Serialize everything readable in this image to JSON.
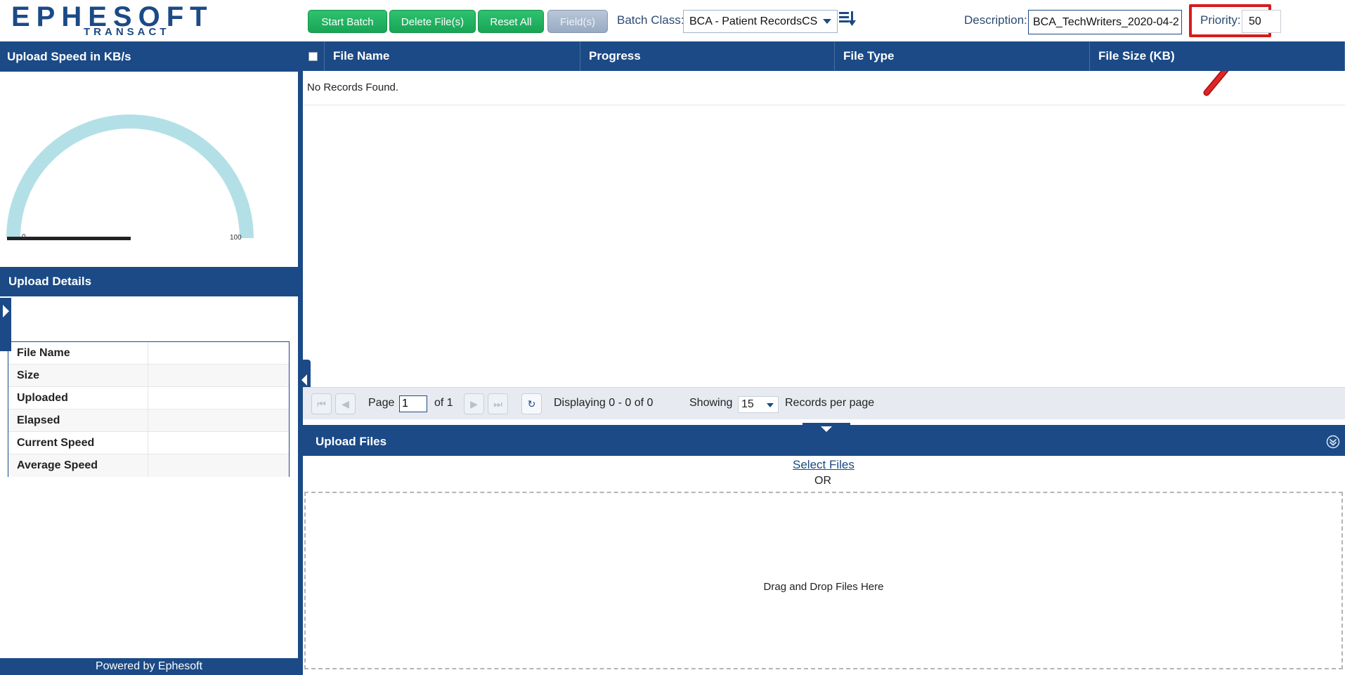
{
  "header": {
    "logo_text": "EPHESOFT",
    "logo_sub": "TRANSACT",
    "buttons": {
      "start_batch": "Start Batch",
      "delete_files": "Delete File(s)",
      "reset_all": "Reset All",
      "fields": "Field(s)"
    },
    "batch_class_label": "Batch Class:",
    "batch_class_value": "BCA - Patient RecordsCS",
    "description_label": "Description:",
    "description_value": "BCA_TechWriters_2020-04-2",
    "priority_label": "Priority:",
    "priority_value": "50"
  },
  "left": {
    "speed_title": "Upload Speed in KB/s",
    "gauge": {
      "min_label": "0",
      "max_label": "100",
      "value": 0
    },
    "details_title": "Upload Details",
    "details_rows": [
      {
        "label": "File Name",
        "value": ""
      },
      {
        "label": "Size",
        "value": ""
      },
      {
        "label": "Uploaded",
        "value": ""
      },
      {
        "label": "Elapsed",
        "value": ""
      },
      {
        "label": "Current Speed",
        "value": ""
      },
      {
        "label": "Average Speed",
        "value": ""
      }
    ],
    "footer": "Powered by Ephesoft"
  },
  "grid": {
    "columns": [
      "File Name",
      "Progress",
      "File Type",
      "File Size (KB)"
    ],
    "empty_message": "No Records Found."
  },
  "pager": {
    "page_label": "Page",
    "page_value": "1",
    "of_label": "of 1",
    "displaying": "Displaying 0 - 0 of 0",
    "showing_label": "Showing",
    "per_page_value": "15",
    "per_page_label": "Records per page"
  },
  "upload": {
    "title": "Upload Files",
    "select_files": "Select Files",
    "or_text": "OR",
    "drop_text": "Drag and Drop Files Here"
  },
  "colors": {
    "brand_blue": "#1b4a86",
    "button_green": "#18a556",
    "highlight_red": "#d81b1b",
    "gauge_arc": "#b3e0e6"
  }
}
